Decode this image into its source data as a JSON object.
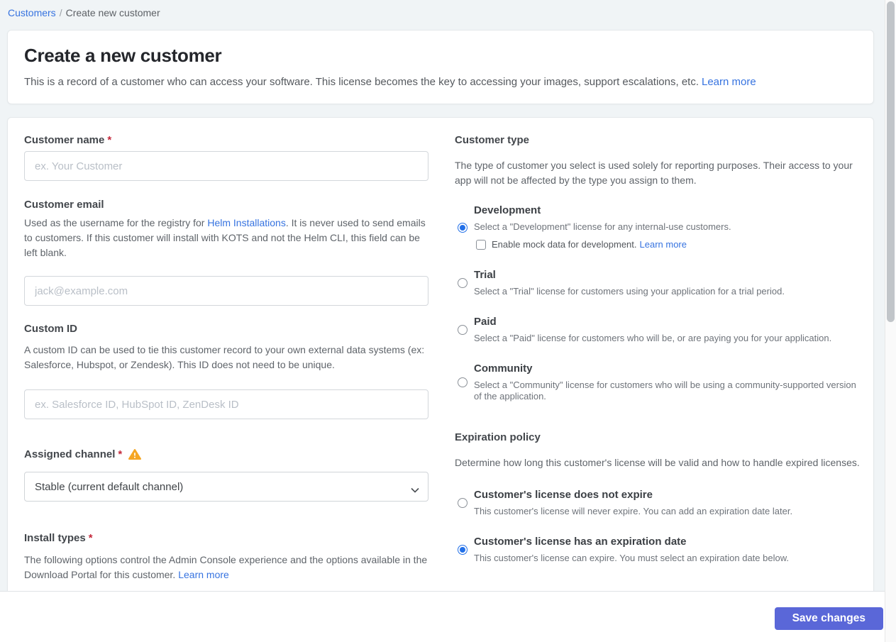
{
  "breadcrumb": {
    "link": "Customers",
    "separator": "/",
    "current": "Create new customer"
  },
  "header": {
    "title": "Create a new customer",
    "description": "This is a record of a customer who can access your software. This license becomes the key to accessing your images, support escalations, etc.",
    "learn_more": "Learn more"
  },
  "form": {
    "customer_name": {
      "label": "Customer name",
      "required": "*",
      "value": "",
      "placeholder": "ex. Your Customer"
    },
    "customer_email": {
      "label": "Customer email",
      "description_before_link": "Used as the username for the registry for ",
      "link": "Helm Installations",
      "description_after_link": ". It is never used to send emails to customers. If this customer will install with KOTS and not the Helm CLI, this field can be left blank.",
      "value": "",
      "placeholder": "jack@example.com"
    },
    "custom_id": {
      "label": "Custom ID",
      "description": "A custom ID can be used to tie this customer record to your own external data systems (ex: Salesforce, Hubspot, or Zendesk). This ID does not need to be unique.",
      "value": "",
      "placeholder": "ex. Salesforce ID, HubSpot ID, ZenDesk ID"
    },
    "assigned_channel": {
      "label": "Assigned channel",
      "required": "*",
      "has_warning": true,
      "selected_option": "Stable (current default channel)"
    },
    "install_types": {
      "label": "Install types",
      "required": "*",
      "description": "The following options control the Admin Console experience and the options available in the Download Portal for this customer.",
      "learn_more": "Learn more"
    },
    "customer_type": {
      "heading": "Customer type",
      "description": "The type of customer you select is used solely for reporting purposes. Their access to your app will not be affected by the type you assign to them.",
      "options": [
        {
          "title": "Development",
          "description": "Select a \"Development\" license for any internal-use customers.",
          "selected": true,
          "checkbox": {
            "label": "Enable mock data for development.",
            "learn_more": "Learn more",
            "checked": false
          }
        },
        {
          "title": "Trial",
          "description": "Select a \"Trial\" license for customers using your application for a trial period.",
          "selected": false
        },
        {
          "title": "Paid",
          "description": "Select a \"Paid\" license for customers who will be, or are paying you for your application.",
          "selected": false
        },
        {
          "title": "Community",
          "description": "Select a \"Community\" license for customers who will be using a community-supported version of the application.",
          "selected": false
        }
      ]
    },
    "expiration_policy": {
      "heading": "Expiration policy",
      "description": "Determine how long this customer's license will be valid and how to handle expired licenses.",
      "options": [
        {
          "title": "Customer's license does not expire",
          "description": "This customer's license will never expire. You can add an expiration date later.",
          "selected": false
        },
        {
          "title": "Customer's license has an expiration date",
          "description": "This customer's license can expire. You must select an expiration date below.",
          "selected": true
        }
      ]
    }
  },
  "footer": {
    "save_label": "Save changes"
  },
  "colors": {
    "page_background": "#f0f4f6",
    "link_blue": "#3673e0",
    "primary_button": "#5a67d8",
    "radio_selected": "#2270e8",
    "warning_amber": "#f5a623",
    "required_red": "#c4283b"
  }
}
